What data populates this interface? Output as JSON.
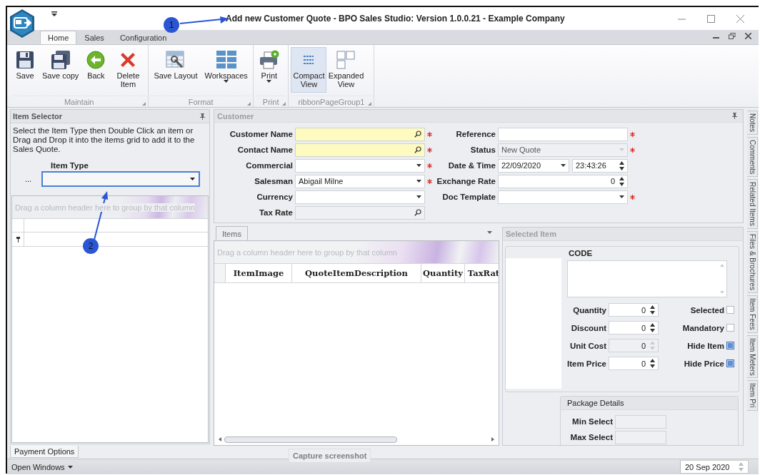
{
  "window": {
    "title": "Add new Customer Quote - BPO Sales Studio: Version 1.0.0.21 - Example Company"
  },
  "ribbon_tabs": [
    {
      "label": "Home",
      "selected": true
    },
    {
      "label": "Sales",
      "selected": false
    },
    {
      "label": "Configuration",
      "selected": false
    }
  ],
  "ribbon_groups": [
    {
      "caption": "Maintain",
      "buttons": [
        {
          "label": "Save",
          "kind": "save",
          "dropdown": false,
          "selected": false
        },
        {
          "label": "Save copy",
          "kind": "copy",
          "dropdown": false,
          "selected": false
        },
        {
          "label": "Back",
          "kind": "back",
          "dropdown": false,
          "selected": false
        },
        {
          "label": "Delete Item",
          "kind": "delete",
          "dropdown": false,
          "selected": false
        }
      ]
    },
    {
      "caption": "Format",
      "buttons": [
        {
          "label": "Save Layout",
          "kind": "layout",
          "dropdown": false,
          "selected": false
        },
        {
          "label": "Workspaces",
          "kind": "tiles",
          "dropdown": true,
          "selected": false
        }
      ]
    },
    {
      "caption": "Print",
      "buttons": [
        {
          "label": "Print",
          "kind": "print",
          "dropdown": true,
          "selected": false
        }
      ]
    },
    {
      "caption": "ribbonPageGroup1",
      "buttons": [
        {
          "label": "Compact View",
          "kind": "compact",
          "dropdown": false,
          "selected": true
        },
        {
          "label": "Expanded View",
          "kind": "expanded",
          "dropdown": false,
          "selected": false
        }
      ]
    }
  ],
  "item_selector": {
    "title": "Item Selector",
    "instructions": "Select the Item Type then Double Click an item or Drag and Drop it into the items grid to add it to the Sales Quote.",
    "item_type_label": "Item Type",
    "ellipsis": "...",
    "item_type_focused": true,
    "group_hint": "Drag a column header here to group by that column"
  },
  "customer": {
    "title": "Customer",
    "left": [
      {
        "label": "Customer Name",
        "kind": "search",
        "required": true,
        "highlighted": true,
        "disabled": false
      },
      {
        "label": "Contact Name",
        "kind": "search",
        "required": true,
        "highlighted": true,
        "disabled": false
      },
      {
        "label": "Commercial",
        "kind": "dropdown",
        "required": true,
        "highlighted": false,
        "disabled": false
      },
      {
        "label": "Salesman",
        "kind": "dropdown",
        "value": "Abigail Milne",
        "required": true,
        "highlighted": false,
        "disabled": false
      },
      {
        "label": "Currency",
        "kind": "dropdown",
        "required": false,
        "highlighted": false,
        "disabled": false
      },
      {
        "label": "Tax Rate",
        "kind": "search",
        "required": false,
        "highlighted": false,
        "disabled": true
      }
    ],
    "right": [
      {
        "label": "Reference",
        "kind": "text",
        "required": true,
        "highlighted": false,
        "disabled": false
      },
      {
        "label": "Status",
        "kind": "dropdown",
        "value": "New Quote",
        "required": true,
        "highlighted": false,
        "disabled": true
      },
      {
        "label": "Date & Time",
        "kind": "datetime",
        "date": "22/09/2020",
        "time": "23:43:26",
        "required": false,
        "highlighted": false,
        "disabled": false
      },
      {
        "label": "Exchange Rate",
        "kind": "spin",
        "value": "0",
        "required": false,
        "highlighted": false,
        "disabled": false
      },
      {
        "label": "Doc Template",
        "kind": "dropdown",
        "required": true,
        "highlighted": false,
        "disabled": false
      }
    ]
  },
  "items": {
    "tab": "Items",
    "group_hint": "Drag a column header here to group by that column",
    "columns": [
      "ItemImage",
      "QuoteItemDescription",
      "Quantity",
      "TaxRat"
    ]
  },
  "selected_item": {
    "title": "Selected Item",
    "code_label": "CODE",
    "fields": [
      {
        "label": "Quantity",
        "value": "0",
        "disabled": false
      },
      {
        "label": "Discount",
        "value": "0",
        "disabled": false
      },
      {
        "label": "Unit Cost",
        "value": "0",
        "disabled": true
      },
      {
        "label": "Item Price",
        "value": "0",
        "disabled": false
      }
    ],
    "flags": [
      {
        "label": "Selected",
        "checked": false
      },
      {
        "label": "Mandatory",
        "checked": false
      },
      {
        "label": "Hide Item",
        "checked": true
      },
      {
        "label": "Hide Price",
        "checked": true
      }
    ],
    "package": {
      "title": "Package Details",
      "fields": [
        "Min Select",
        "Max Select"
      ]
    }
  },
  "side_tabs": [
    "Notes",
    "Comments",
    "Related Items",
    "Files & Brochures",
    "Item Fees",
    "Item Meters",
    "Item Pri"
  ],
  "bottom_tabs": [
    {
      "label": "Payment Options",
      "selected": true
    }
  ],
  "overlay_button": "Capture screenshot",
  "status_bar": {
    "open_windows": "Open Windows",
    "date": "20 Sep 2020"
  },
  "annotations": [
    {
      "number": "1"
    },
    {
      "number": "2"
    }
  ]
}
